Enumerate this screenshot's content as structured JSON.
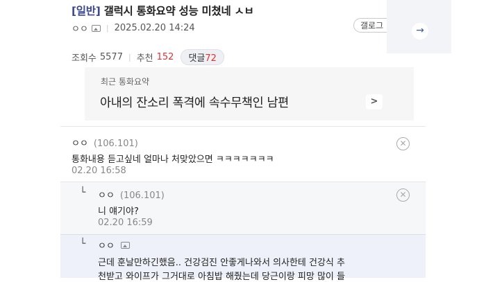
{
  "post": {
    "category": "[일반]",
    "title": "갤럭시 통화요약 성능 미쳤네 ㅅㅂ",
    "author": "ㅇㅇ",
    "datetime": "2025.02.20 14:24",
    "gallery_button": "갤로그",
    "views_label": "조회수",
    "views": "5577",
    "recommend_label": "추천",
    "recommend": "152",
    "comments_label": "댓글",
    "comments": "72"
  },
  "recent_summary": {
    "label": "최근 통화요약",
    "text": "아내의 잔소리 폭격에 속수무책인 남편"
  },
  "comments": [
    {
      "author": "ㅇㅇ",
      "ip": "(106.101)",
      "text": "통화내용 듣고싶네 얼마나 처맞았으면 ㅋㅋㅋㅋㅋㅋㅋ",
      "date": "02.20 16:58"
    },
    {
      "author": "ㅇㅇ",
      "ip": "(106.101)",
      "text": "니 얘기야?",
      "date": "02.20 16:59"
    },
    {
      "author": "ㅇㅇ",
      "text1": "근데 훈날만하긴했음.. 건강검진 안좋게나와서 의사한테 건강식 추",
      "text2": "천받고 와이프가 그거대로 아침밥 해줬는데 당근이랑 피망 많이 들"
    }
  ],
  "icons": {
    "arrow": "arrow-right-icon",
    "close": "close-circle-icon",
    "chevron": "chevron-right-icon",
    "image": "image-icon",
    "reply": "reply-icon"
  },
  "colors": {
    "accent": "#3b4890",
    "red": "#dd3333"
  }
}
